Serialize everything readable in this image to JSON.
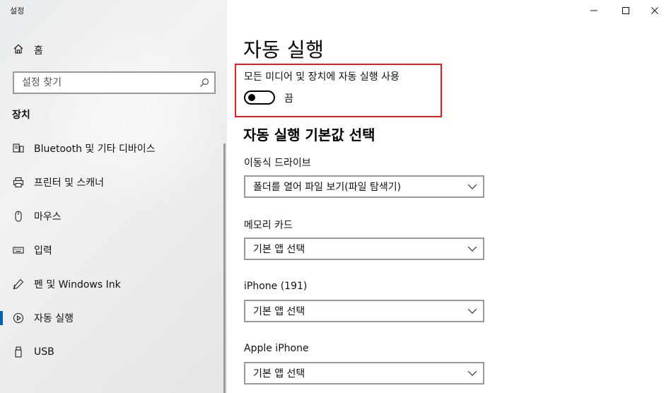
{
  "window": {
    "title": "설정",
    "controls": {
      "minimize": "minimize-icon",
      "maximize": "maximize-icon",
      "close": "close-icon"
    }
  },
  "sidebar": {
    "home_label": "홈",
    "search_placeholder": "설정 찾기",
    "section_title": "장치",
    "items": [
      {
        "label": "Bluetooth 및 기타 디바이스",
        "icon": "bluetooth-devices-icon"
      },
      {
        "label": "프린터 및 스캐너",
        "icon": "printer-icon"
      },
      {
        "label": "마우스",
        "icon": "mouse-icon"
      },
      {
        "label": "입력",
        "icon": "keyboard-icon"
      },
      {
        "label": "펜 및 Windows Ink",
        "icon": "pen-icon"
      },
      {
        "label": "자동 실행",
        "icon": "autoplay-icon",
        "selected": true
      },
      {
        "label": "USB",
        "icon": "usb-icon"
      }
    ],
    "selected_accent": "#0063b1"
  },
  "main": {
    "title": "자동 실행",
    "toggle": {
      "label": "모든 미디어 및 장치에 자동 실행 사용",
      "state": "끔",
      "on": false
    },
    "highlight_color": "#e02020",
    "defaults_title": "자동 실행 기본값 선택",
    "defaults": [
      {
        "label": "이동식 드라이브",
        "value": "폴더를 열어 파일 보기(파일 탐색기)"
      },
      {
        "label": "메모리 카드",
        "value": "기본 앱 선택"
      },
      {
        "label": "iPhone (191)",
        "value": "기본 앱 선택"
      },
      {
        "label": "Apple iPhone",
        "value": "기본 앱 선택"
      }
    ]
  }
}
